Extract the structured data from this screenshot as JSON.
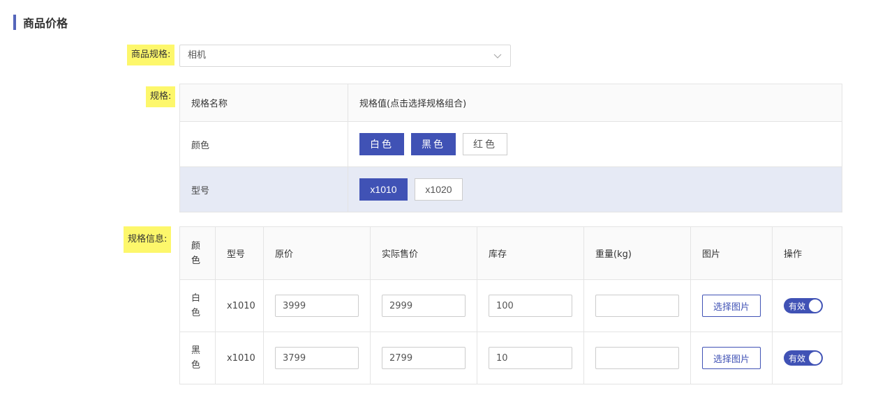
{
  "section": {
    "title": "商品价格"
  },
  "labels": {
    "spec_select": "商品规格:",
    "spec": "规格:",
    "spec_info": "规格信息:"
  },
  "spec_select": {
    "value": "相机"
  },
  "spec_table": {
    "header_name": "规格名称",
    "header_values": "规格值(点击选择规格组合)",
    "rows": [
      {
        "name": "颜色",
        "options": [
          {
            "label": "白色",
            "selected": true
          },
          {
            "label": "黑色",
            "selected": true
          },
          {
            "label": "红色",
            "selected": false
          }
        ]
      },
      {
        "name": "型号",
        "options": [
          {
            "label": "x1010",
            "selected": true
          },
          {
            "label": "x1020",
            "selected": false
          }
        ]
      }
    ]
  },
  "info_table": {
    "headers": [
      "颜色",
      "型号",
      "原价",
      "实际售价",
      "库存",
      "重量(kg)",
      "图片",
      "操作"
    ],
    "rows": [
      {
        "color": "白色",
        "model": "x1010",
        "original_price": "3999",
        "sale_price": "2999",
        "stock": "100",
        "weight": "",
        "image_button": "选择图片",
        "status": "有效"
      },
      {
        "color": "黑色",
        "model": "x1010",
        "original_price": "3799",
        "sale_price": "2799",
        "stock": "10",
        "weight": "",
        "image_button": "选择图片",
        "status": "有效"
      }
    ]
  },
  "colors": {
    "accent": "#4052b5",
    "highlight": "#fdf76b"
  }
}
